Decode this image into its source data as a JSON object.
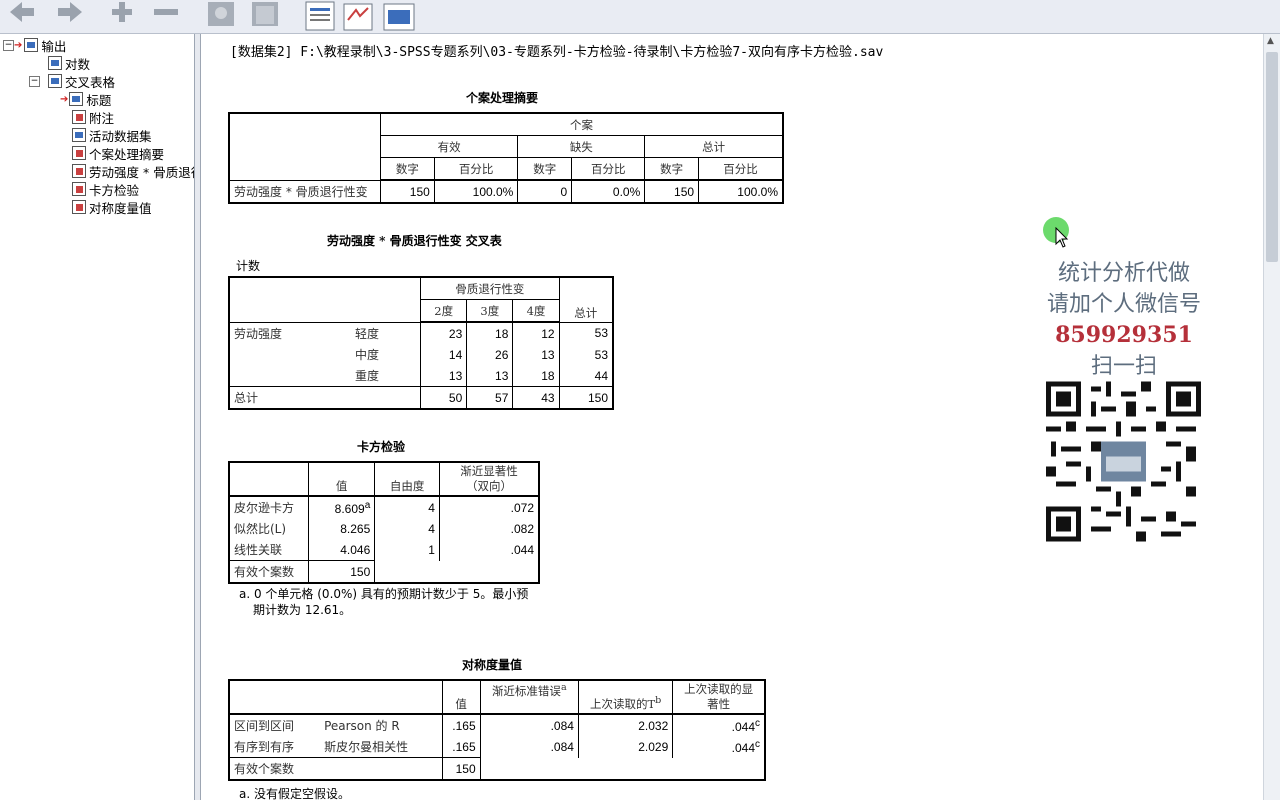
{
  "tree": {
    "root": "输出",
    "log": "对数",
    "crosstabs": "交叉表格",
    "items": [
      "标题",
      "附注",
      "活动数据集",
      "个案处理摘要",
      "劳动强度 * 骨质退行",
      "卡方检验",
      "对称度量值"
    ]
  },
  "dataset_line": "[数据集2] F:\\教程录制\\3-SPSS专题系列\\03-专题系列-卡方检验-待录制\\卡方检验7-双向有序卡方检验.sav",
  "case_summary": {
    "title": "个案处理摘要",
    "h_case": "个案",
    "h_valid": "有效",
    "h_missing": "缺失",
    "h_total": "总计",
    "h_n": "数字",
    "h_pct": "百分比",
    "row_label": "劳动强度 * 骨质退行性变",
    "values": [
      "150",
      "100.0%",
      "0",
      "0.0%",
      "150",
      "100.0%"
    ]
  },
  "crosstab": {
    "title": "劳动强度 * 骨质退行性变 交叉表",
    "subtitle": "计数",
    "col_var": "骨质退行性变",
    "cols": [
      "2度",
      "3度",
      "4度"
    ],
    "total_label": "总计",
    "row_var": "劳动强度",
    "rows": [
      {
        "label": "轻度",
        "values": [
          "23",
          "18",
          "12",
          "53"
        ]
      },
      {
        "label": "中度",
        "values": [
          "14",
          "26",
          "13",
          "53"
        ]
      },
      {
        "label": "重度",
        "values": [
          "13",
          "13",
          "18",
          "44"
        ]
      }
    ],
    "total_row": {
      "label": "总计",
      "values": [
        "50",
        "57",
        "43",
        "150"
      ]
    }
  },
  "chisq": {
    "title": "卡方检验",
    "h_value": "值",
    "h_df": "自由度",
    "h_sig": "渐近显著性",
    "h_sig2": "（双向）",
    "rows": [
      {
        "label": "皮尔逊卡方",
        "value": "8.609",
        "sup": "a",
        "df": "4",
        "sig": ".072"
      },
      {
        "label": "似然比(L)",
        "value": "8.265",
        "sup": "",
        "df": "4",
        "sig": ".082"
      },
      {
        "label": "线性关联",
        "value": "4.046",
        "sup": "",
        "df": "1",
        "sig": ".044"
      },
      {
        "label": "有效个案数",
        "value": "150",
        "sup": "",
        "df": "",
        "sig": ""
      }
    ],
    "footnote_1": "a. 0 个单元格 (0.0%) 具有的预期计数少于 5。最小预",
    "footnote_2": "期计数为 12.61。"
  },
  "symm": {
    "title": "对称度量值",
    "h_value": "值",
    "h_ase": "渐近标准错误",
    "h_ase_sup": "a",
    "h_t": "上次读取的T",
    "h_t_sup": "b",
    "h_sig": "上次读取的显",
    "h_sig2": "著性",
    "rows": [
      {
        "g": "区间到区间",
        "m": "Pearson 的 R",
        "value": ".165",
        "ase": ".084",
        "t": "2.032",
        "sig": ".044",
        "sup": "c"
      },
      {
        "g": "有序到有序",
        "m": "斯皮尔曼相关性",
        "value": ".165",
        "ase": ".084",
        "t": "2.029",
        "sig": ".044",
        "sup": "c"
      },
      {
        "g": "有效个案数",
        "m": "",
        "value": "150",
        "ase": "",
        "t": "",
        "sig": "",
        "sup": ""
      }
    ],
    "footnote": "a. 没有假定空假设。"
  },
  "watermark": {
    "line1": "统计分析代做",
    "line2_prefix": "请加个人微信号",
    "line2_number": "859929351",
    "line3": "扫一扫"
  },
  "colors": {
    "toolbar": "#e9ecf3",
    "watermark_text": "#5d6d7e",
    "watermark_number": "#b5303a",
    "cursor_highlight": "#5cd65c"
  }
}
